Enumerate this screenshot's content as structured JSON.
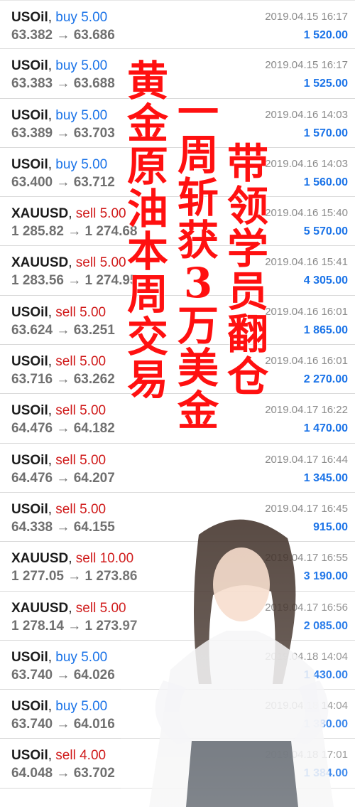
{
  "trades": [
    {
      "symbol": "USOil",
      "direction": "buy",
      "volume": "5.00",
      "open": "63.382",
      "close": "63.686",
      "time": "2019.04.15 16:17",
      "profit": "1 520.00"
    },
    {
      "symbol": "USOil",
      "direction": "buy",
      "volume": "5.00",
      "open": "63.383",
      "close": "63.688",
      "time": "2019.04.15 16:17",
      "profit": "1 525.00"
    },
    {
      "symbol": "USOil",
      "direction": "buy",
      "volume": "5.00",
      "open": "63.389",
      "close": "63.703",
      "time": "2019.04.16 14:03",
      "profit": "1 570.00"
    },
    {
      "symbol": "USOil",
      "direction": "buy",
      "volume": "5.00",
      "open": "63.400",
      "close": "63.712",
      "time": "2019.04.16 14:03",
      "profit": "1 560.00"
    },
    {
      "symbol": "XAUUSD",
      "direction": "sell",
      "volume": "5.00",
      "open": "1 285.82",
      "close": "1 274.68",
      "time": "2019.04.16 15:40",
      "profit": "5 570.00"
    },
    {
      "symbol": "XAUUSD",
      "direction": "sell",
      "volume": "5.00",
      "open": "1 283.56",
      "close": "1 274.95",
      "time": "2019.04.16 15:41",
      "profit": "4 305.00"
    },
    {
      "symbol": "USOil",
      "direction": "sell",
      "volume": "5.00",
      "open": "63.624",
      "close": "63.251",
      "time": "2019.04.16 16:01",
      "profit": "1 865.00"
    },
    {
      "symbol": "USOil",
      "direction": "sell",
      "volume": "5.00",
      "open": "63.716",
      "close": "63.262",
      "time": "2019.04.16 16:01",
      "profit": "2 270.00"
    },
    {
      "symbol": "USOil",
      "direction": "sell",
      "volume": "5.00",
      "open": "64.476",
      "close": "64.182",
      "time": "2019.04.17 16:22",
      "profit": "1 470.00"
    },
    {
      "symbol": "USOil",
      "direction": "sell",
      "volume": "5.00",
      "open": "64.476",
      "close": "64.207",
      "time": "2019.04.17 16:44",
      "profit": "1 345.00"
    },
    {
      "symbol": "USOil",
      "direction": "sell",
      "volume": "5.00",
      "open": "64.338",
      "close": "64.155",
      "time": "2019.04.17 16:45",
      "profit": "915.00"
    },
    {
      "symbol": "XAUUSD",
      "direction": "sell",
      "volume": "10.00",
      "open": "1 277.05",
      "close": "1 273.86",
      "time": "2019.04.17 16:55",
      "profit": "3 190.00"
    },
    {
      "symbol": "XAUUSD",
      "direction": "sell",
      "volume": "5.00",
      "open": "1 278.14",
      "close": "1 273.97",
      "time": "2019.04.17 16:56",
      "profit": "2 085.00"
    },
    {
      "symbol": "USOil",
      "direction": "buy",
      "volume": "5.00",
      "open": "63.740",
      "close": "64.026",
      "time": "2019.04.18 14:04",
      "profit": "1 430.00"
    },
    {
      "symbol": "USOil",
      "direction": "buy",
      "volume": "5.00",
      "open": "63.740",
      "close": "64.016",
      "time": "2019.04.18 14:04",
      "profit": "1 380.00"
    },
    {
      "symbol": "USOil",
      "direction": "sell",
      "volume": "4.00",
      "open": "64.048",
      "close": "63.702",
      "time": "2019.04.18 17:01",
      "profit": "1 384.00"
    }
  ],
  "arrow": "→",
  "overlay": {
    "col1": [
      "黄",
      "金",
      "原",
      "油",
      "本",
      "周",
      "交",
      "易"
    ],
    "col2": [
      "一",
      "周",
      "斩",
      "获",
      "3",
      "万",
      "美",
      "金"
    ],
    "col3": [
      "带",
      "领",
      "学",
      "员",
      "翻",
      "仓"
    ]
  },
  "colors": {
    "buy": "#1a73e8",
    "sell": "#d01a1a",
    "profit": "#1a73e8",
    "headline": "#ff1010"
  }
}
